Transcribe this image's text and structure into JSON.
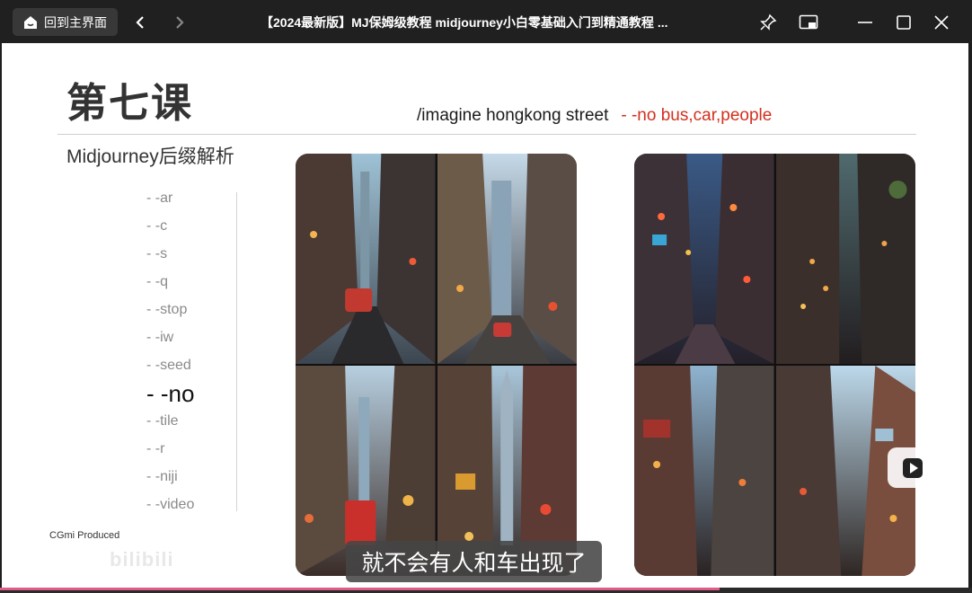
{
  "titlebar": {
    "home_label": "回到主界面",
    "title": "【2024最新版】MJ保姆级教程 midjourney小白零基础入门到精通教程 ..."
  },
  "slide": {
    "lesson_title": "第七课",
    "prompt_main": "/imagine hongkong street",
    "prompt_no": "- -no bus,car,people",
    "subtitle": "Midjourney后缀解析",
    "params": [
      "- -ar",
      "- -c",
      "- -s",
      "- -q",
      "- -stop",
      "- -iw",
      "- -seed",
      "- -no",
      "- -tile",
      "- -r",
      "- -niji",
      "- -video"
    ],
    "active_param": "- -no",
    "credit": "CGmi Produced",
    "watermark": "bilibili"
  },
  "player": {
    "caption": "就不会有人和车出现了",
    "progress": 0.74,
    "progress_color": "#e05b8a"
  },
  "colors": {
    "accent_red": "#d2301e"
  }
}
